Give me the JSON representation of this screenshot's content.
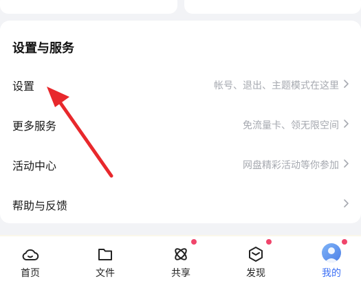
{
  "section": {
    "title": "设置与服务",
    "items": [
      {
        "label": "设置",
        "hint": "帐号、退出、主题模式在这里"
      },
      {
        "label": "更多服务",
        "hint": "免流量卡、领无限空间"
      },
      {
        "label": "活动中心",
        "hint": "网盘精彩活动等你参加"
      },
      {
        "label": "帮助与反馈",
        "hint": ""
      }
    ]
  },
  "tabbar": {
    "tabs": [
      {
        "label": "首页",
        "icon": "cloud-home-icon",
        "badge": false
      },
      {
        "label": "文件",
        "icon": "folder-icon",
        "badge": false
      },
      {
        "label": "共享",
        "icon": "atom-share-icon",
        "badge": true
      },
      {
        "label": "发现",
        "icon": "cube-discover-icon",
        "badge": true
      },
      {
        "label": "我的",
        "icon": "avatar",
        "badge": true,
        "active": true
      }
    ]
  },
  "colors": {
    "background": "#f2f3f6",
    "card": "#ffffff",
    "hint_text": "#a6a9b0",
    "active_tab": "#3b6ff5",
    "badge": "#f0456b",
    "annotation_arrow": "#e8282c"
  }
}
